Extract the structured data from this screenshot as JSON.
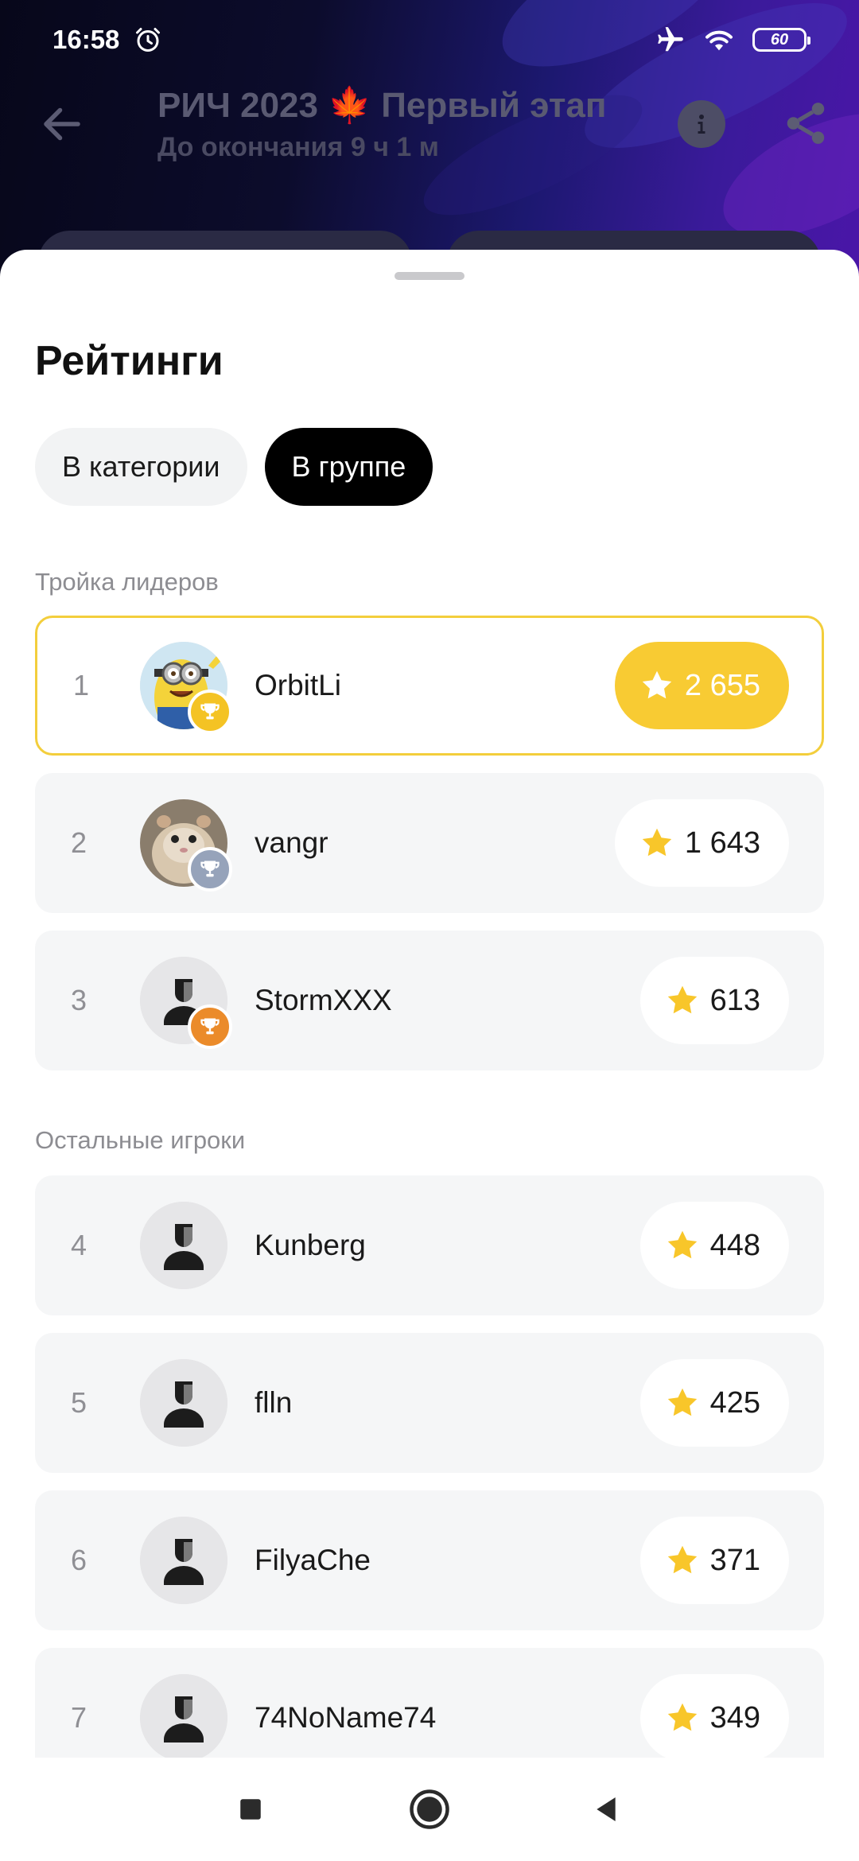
{
  "status_bar": {
    "time": "16:58",
    "battery": "60",
    "icons": [
      "alarm-icon",
      "airplane-icon",
      "wifi-icon",
      "battery-icon"
    ]
  },
  "header": {
    "title": "РИЧ 2023 🍁 Первый этап",
    "subtitle": "До окончания 9 ч 1 м",
    "icons": [
      "back-arrow-icon",
      "info-icon",
      "share-icon"
    ]
  },
  "sheet": {
    "title": "Рейтинги",
    "tabs": [
      {
        "label": "В категории",
        "active": false
      },
      {
        "label": "В группе",
        "active": true
      }
    ],
    "leaders_label": "Тройка лидеров",
    "others_label": "Остальные игроки",
    "leaders": [
      {
        "rank": "1",
        "name": "OrbitLi",
        "score": "2 655",
        "medal": "gold",
        "avatar": "minion-avatar"
      },
      {
        "rank": "2",
        "name": "vangr",
        "score": "1 643",
        "medal": "silver",
        "avatar": "hamster-avatar"
      },
      {
        "rank": "3",
        "name": "StormXXX",
        "score": "613",
        "medal": "bronze",
        "avatar": "default-avatar"
      }
    ],
    "others": [
      {
        "rank": "4",
        "name": "Kunberg",
        "score": "448"
      },
      {
        "rank": "5",
        "name": "flln",
        "score": "425"
      },
      {
        "rank": "6",
        "name": "FilyaChe",
        "score": "371"
      },
      {
        "rank": "7",
        "name": "74NoName74",
        "score": "349"
      }
    ]
  },
  "colors": {
    "accent_yellow": "#f8cb33",
    "gold_border": "#f3ce3c",
    "silver_medal": "#96a3ba",
    "bronze_medal": "#eb8b2a",
    "row_bg": "#f5f6f7"
  },
  "navbar": {
    "icons": [
      "recents-square-icon",
      "home-circle-icon",
      "back-triangle-icon"
    ]
  }
}
